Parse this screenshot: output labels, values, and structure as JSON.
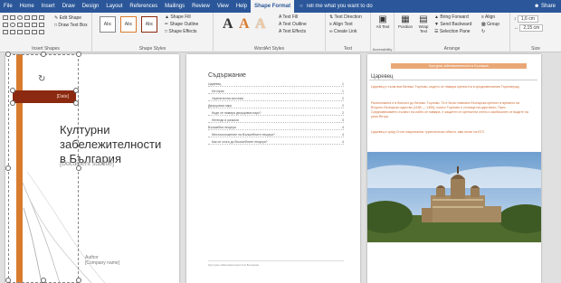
{
  "tabs": [
    "File",
    "Home",
    "Insert",
    "Draw",
    "Design",
    "Layout",
    "References",
    "Mailings",
    "Review",
    "View",
    "Help",
    "Shape Format"
  ],
  "active_tab": "Shape Format",
  "tell_me": "Tell me what you want to do",
  "share": "Share",
  "ribbon": {
    "insert_shapes": {
      "label": "Insert Shapes",
      "edit_shape": "Edit Shape",
      "draw_text_box": "Draw Text Box"
    },
    "shape_styles": {
      "label": "Shape Styles",
      "style_label": "Abc",
      "fill": "Shape Fill",
      "outline": "Shape Outline",
      "effects": "Shape Effects"
    },
    "wordart": {
      "label": "WordArt Styles",
      "letter": "A",
      "text_fill": "Text Fill",
      "text_outline": "Text Outline",
      "text_effects": "Text Effects"
    },
    "text": {
      "label": "Text",
      "direction": "Text Direction",
      "align": "Align Text",
      "create_link": "Create Link"
    },
    "accessibility": {
      "label": "Accessibility",
      "alt_text": "Alt Text"
    },
    "arrange": {
      "label": "Arrange",
      "position": "Position",
      "wrap": "Wrap Text",
      "bring_forward": "Bring Forward",
      "send_backward": "Send Backward",
      "selection_pane": "Selection Pane",
      "align": "Align",
      "group": "Group",
      "rotate": "Rotate"
    },
    "size": {
      "label": "Size",
      "height": "1,6 cm",
      "width": "2,15 cm"
    }
  },
  "page1": {
    "date": "[Date]",
    "title_lines": [
      "Културни",
      "забележителности",
      "в България"
    ],
    "subtitle": "[Document subtitle]",
    "author": "Author",
    "company": "[Company name]"
  },
  "page2": {
    "toc_title": "Съдържание",
    "toc": [
      {
        "text": "Царевец",
        "num": "1"
      },
      {
        "text": "История",
        "num": "1"
      },
      {
        "text": "Укрепителна система",
        "num": "2"
      },
      {
        "text": "Дворцовия парк",
        "num": "2"
      },
      {
        "text": "Къде се намира дворцовия парк?",
        "num": "2"
      },
      {
        "text": "Легенди и разкази",
        "num": "3"
      },
      {
        "text": "Вълшебни пещери",
        "num": "4"
      },
      {
        "text": "Местоположение на Вълшебните пещери?",
        "num": "4"
      },
      {
        "text": "Как се стига до Вълшебните пещери?",
        "num": "4"
      }
    ],
    "footer": "Културни забележителности в България"
  },
  "page3": {
    "banner": "Културни забележителности в България",
    "heading": "Царевец",
    "paragraphs": [
      "Царевец е хълм във Велико Търново, където се намира крепостта в средновековния Търновград.",
      "Разположена е в близост до Велико Търново. Тя е била главната българска крепост в времето на Второто българско царство (1185 — 1396), когато Търново е столица на царството. През Средновековието хълмът на който се намира, е защитен от крепостни стени и заобиколен от водите на река Янтра.",
      "Царевец е сред Стоте национални туристически обекта, има печат на БТС."
    ]
  },
  "colors": {
    "accent": "#2b579a",
    "orange": "#d97b2e",
    "dark_red": "#8b2a10",
    "text_orange": "#d06a32"
  }
}
